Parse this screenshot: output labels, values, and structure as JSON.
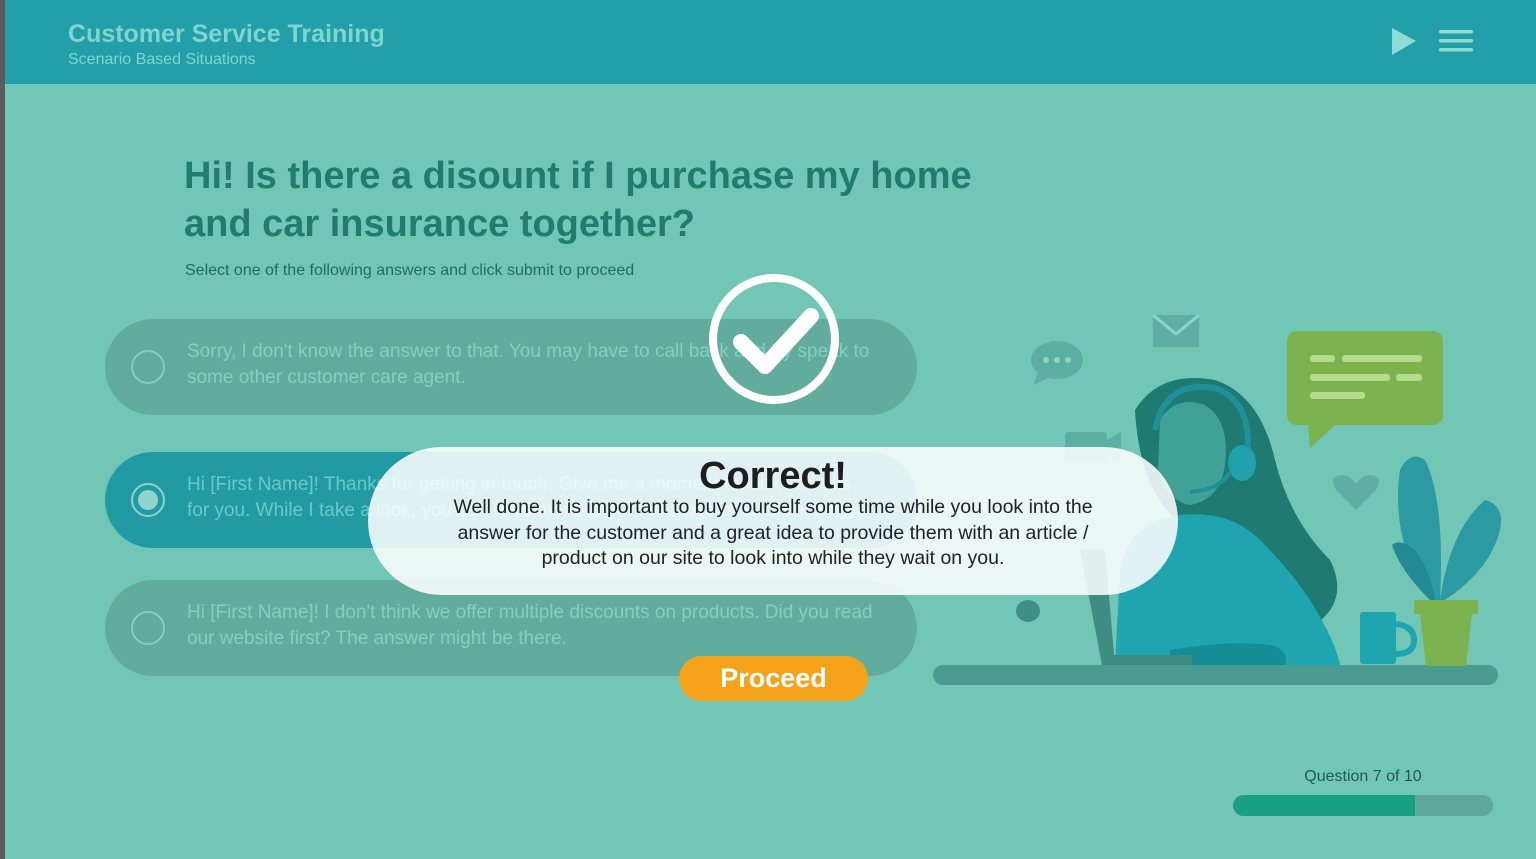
{
  "header": {
    "title": "Customer Service Training",
    "subtitle": "Scenario Based Situations",
    "play_icon": "play-icon",
    "menu_icon": "hamburger-menu-icon"
  },
  "question": {
    "text": "Hi! Is there a disount if I purchase my home and car insurance together?",
    "instruction": "Select one of the following answers and click submit to proceed"
  },
  "answers": [
    {
      "text": "Sorry, I don't know the answer to that. You may have to call back and try speak to some other customer care agent.",
      "selected": false
    },
    {
      "text": "Hi [First Name]! Thanks for getting in touch. Give me a moment to look into this for you. While I take a look, you can read more about the types of insurance ",
      "link_text": "here",
      "selected": true
    },
    {
      "text": "Hi [First Name]! I don't think we offer multiple discounts on products. Did you read our website first? The answer might be there.",
      "selected": false
    }
  ],
  "feedback": {
    "icon": "checkmark-circle-icon",
    "title": "Correct!",
    "body": "Well done. It is important to buy yourself some time while you look into the answer for the customer and a great idea to provide them with an article / product on our site to look into while they wait on you.",
    "proceed_label": "Proceed"
  },
  "progress": {
    "label": "Question 7 of 10",
    "current": 7,
    "total": 10,
    "fraction": 0.7
  },
  "colors": {
    "background": "#72c6b6",
    "header": "#229fa9",
    "accent": "#f4a21b",
    "progress_fill": "#18a081"
  }
}
